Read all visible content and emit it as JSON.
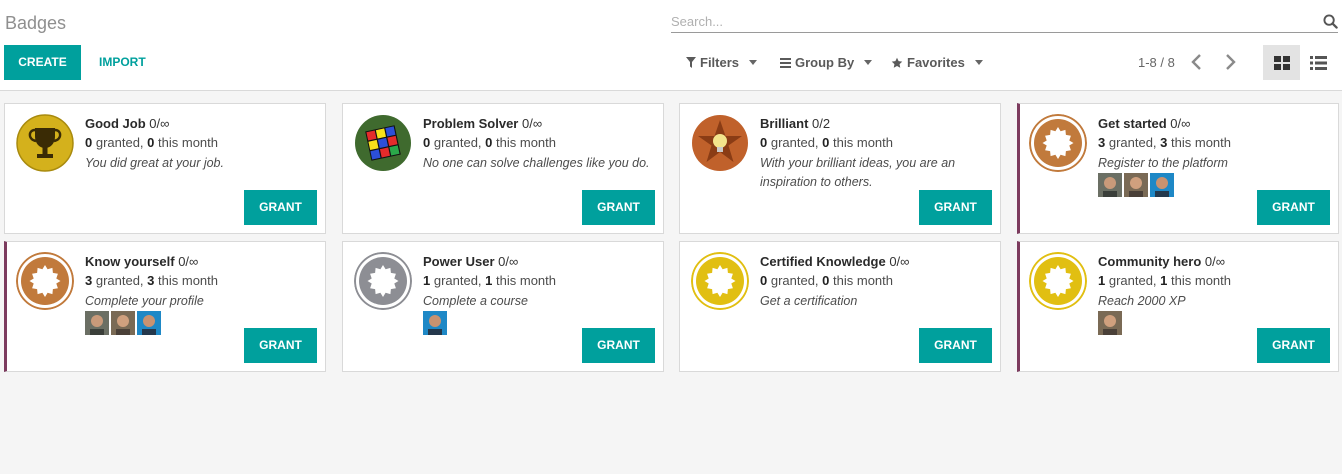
{
  "page": {
    "title": "Badges"
  },
  "toolbar": {
    "create_label": "CREATE",
    "import_label": "IMPORT"
  },
  "search": {
    "placeholder": "Search...",
    "filters_label": "Filters",
    "group_by_label": "Group By",
    "favorites_label": "Favorites"
  },
  "pager": {
    "text": "1-8 / 8"
  },
  "colors": {
    "accent": "#00a09d",
    "flag": "#7c3b5e"
  },
  "badges": [
    {
      "name": "Good Job",
      "limit": "0/∞",
      "granted": "0",
      "this_month": "0",
      "granted_word": " granted, ",
      "month_word": " this month",
      "description": "You did great at your job.",
      "icon": "trophy-icon",
      "avatars": [],
      "grant_label": "GRANT"
    },
    {
      "name": "Problem Solver",
      "limit": "0/∞",
      "granted": "0",
      "this_month": "0",
      "granted_word": " granted, ",
      "month_word": " this month",
      "description": "No one can solve challenges like you do.",
      "icon": "rubiks-cube-icon",
      "avatars": [],
      "grant_label": "GRANT"
    },
    {
      "name": "Brilliant",
      "limit": "0/2",
      "granted": "0",
      "this_month": "0",
      "granted_word": " granted, ",
      "month_word": " this month",
      "description": "With your brilliant ideas, you are an inspiration to others.",
      "icon": "lightbulb-star-icon",
      "avatars": [],
      "grant_label": "GRANT"
    },
    {
      "name": "Get started",
      "limit": "0/∞",
      "granted": "3",
      "this_month": "3",
      "granted_word": " granted, ",
      "month_word": " this month",
      "description": "Register to the platform",
      "icon": "bronze-seal-icon",
      "avatars": [
        "user-avatar",
        "user-avatar",
        "user-avatar"
      ],
      "grant_label": "GRANT"
    },
    {
      "name": "Know yourself",
      "limit": "0/∞",
      "granted": "3",
      "this_month": "3",
      "granted_word": " granted, ",
      "month_word": " this month",
      "description": "Complete your profile",
      "icon": "bronze-seal-icon",
      "avatars": [
        "user-avatar",
        "user-avatar",
        "user-avatar"
      ],
      "grant_label": "GRANT"
    },
    {
      "name": "Power User",
      "limit": "0/∞",
      "granted": "1",
      "this_month": "1",
      "granted_word": " granted, ",
      "month_word": " this month",
      "description": "Complete a course",
      "icon": "silver-seal-icon",
      "avatars": [
        "user-avatar"
      ],
      "grant_label": "GRANT"
    },
    {
      "name": "Certified Knowledge",
      "limit": "0/∞",
      "granted": "0",
      "this_month": "0",
      "granted_word": " granted, ",
      "month_word": " this month",
      "description": "Get a certification",
      "icon": "gold-seal-icon",
      "avatars": [],
      "grant_label": "GRANT"
    },
    {
      "name": "Community hero",
      "limit": "0/∞",
      "granted": "1",
      "this_month": "1",
      "granted_word": " granted, ",
      "month_word": " this month",
      "description": "Reach 2000 XP",
      "icon": "gold-seal-icon",
      "avatars": [
        "user-avatar"
      ],
      "grant_label": "GRANT"
    }
  ]
}
